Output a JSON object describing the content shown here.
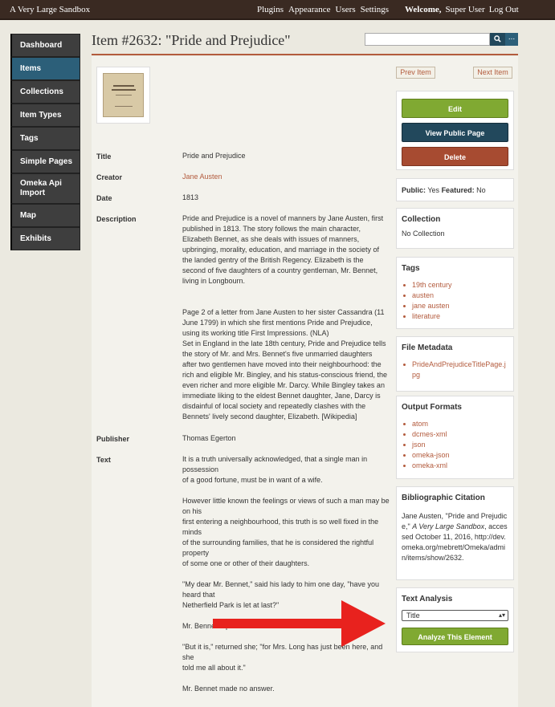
{
  "topbar": {
    "site_title": "A Very Large Sandbox",
    "nav": [
      "Plugins",
      "Appearance",
      "Users",
      "Settings"
    ],
    "welcome": "Welcome,",
    "user": "Super User",
    "logout": "Log Out"
  },
  "sidebar": {
    "items": [
      {
        "label": "Dashboard",
        "active": false
      },
      {
        "label": "Items",
        "active": true
      },
      {
        "label": "Collections",
        "active": false
      },
      {
        "label": "Item Types",
        "active": false
      },
      {
        "label": "Tags",
        "active": false
      },
      {
        "label": "Simple Pages",
        "active": false
      },
      {
        "label": "Omeka Api Import",
        "active": false
      },
      {
        "label": "Map",
        "active": false
      },
      {
        "label": "Exhibits",
        "active": false
      }
    ]
  },
  "header": {
    "title": "Item #2632: \"Pride and Prejudice\"",
    "search_placeholder": "",
    "search_icon": "search-icon",
    "advanced_icon": "ellipsis-icon",
    "advanced_label": "..."
  },
  "metadata": {
    "title_label": "Title",
    "title_value": "Pride and Prejudice",
    "creator_label": "Creator",
    "creator_value": "Jane Austen",
    "date_label": "Date",
    "date_value": "1813",
    "description_label": "Description",
    "description_p1": "Pride and Prejudice is a novel of manners by Jane Austen, first published in 1813. The story follows the main character, Elizabeth Bennet, as she deals with issues of manners, upbringing, morality, education, and marriage in the society of the landed gentry of the British Regency. Elizabeth is the second of five daughters of a country gentleman, Mr. Bennet, living in Longbourn.",
    "description_p2": "Page 2 of a letter from Jane Austen to her sister Cassandra (11 June 1799) in which she first mentions Pride and Prejudice, using its working title First Impressions. (NLA)",
    "description_p3": "Set in England in the late 18th century, Pride and Prejudice tells the story of Mr. and Mrs. Bennet's five unmarried daughters after two gentlemen have moved into their neighbourhood: the rich and eligible Mr. Bingley, and his status-conscious friend, the even richer and more eligible Mr. Darcy. While Bingley takes an immediate liking to the eldest Bennet daughter, Jane, Darcy is disdainful of local society and repeatedly clashes with the Bennets' lively second daughter, Elizabeth. [Wikipedia]",
    "publisher_label": "Publisher",
    "publisher_value": "Thomas Egerton",
    "text_label": "Text",
    "text_lines": [
      "It is a truth universally acknowledged, that a single man in possession",
      "of a good fortune, must be in want of a wife.",
      "",
      "However little known the feelings or views of such a man may be on his",
      "first entering a neighbourhood, this truth is so well fixed in the minds",
      "of the surrounding families, that he is considered the rightful property",
      "of some one or other of their daughters.",
      "",
      "\"My dear Mr. Bennet,\" said his lady to him one day, \"have you heard that",
      "Netherfield Park is let at last?\"",
      "",
      "Mr. Bennet replied that he had not.",
      "",
      "\"But it is,\" returned she; \"for Mrs. Long has just been here, and she",
      "told me all about it.\"",
      "",
      "Mr. Bennet made no answer."
    ]
  },
  "right": {
    "prev_item": "Prev Item",
    "next_item": "Next Item",
    "edit": "Edit",
    "view_public": "View Public Page",
    "delete": "Delete",
    "public_label": "Public:",
    "public_value": "Yes",
    "featured_label": "Featured:",
    "featured_value": "No",
    "collection_title": "Collection",
    "collection_value": "No Collection",
    "tags_title": "Tags",
    "tags": [
      "19th century",
      "austen",
      "jane austen",
      "literature"
    ],
    "file_title": "File Metadata",
    "file_name": "PrideAndPrejudiceTitlePage.jpg",
    "output_title": "Output Formats",
    "outputs": [
      "atom",
      "dcmes-xml",
      "json",
      "omeka-json",
      "omeka-xml"
    ],
    "citation_title": "Bibliographic Citation",
    "citation_pre": "Jane Austen, \"Pride and Prejudice,\"",
    "citation_site": "A Very Large Sandbox",
    "citation_post": ", accessed October 11, 2016, http://dev.omeka.org/mebrett/Omeka/admin/items/show/2632.",
    "text_analysis_title": "Text Analysis",
    "select_value": "Title",
    "analyze_button": "Analyze This Element"
  },
  "colors": {
    "accent": "#b35b3d",
    "green": "#80a932",
    "navy": "#22485c",
    "red": "#a74b31",
    "arrow": "#e8221e"
  }
}
